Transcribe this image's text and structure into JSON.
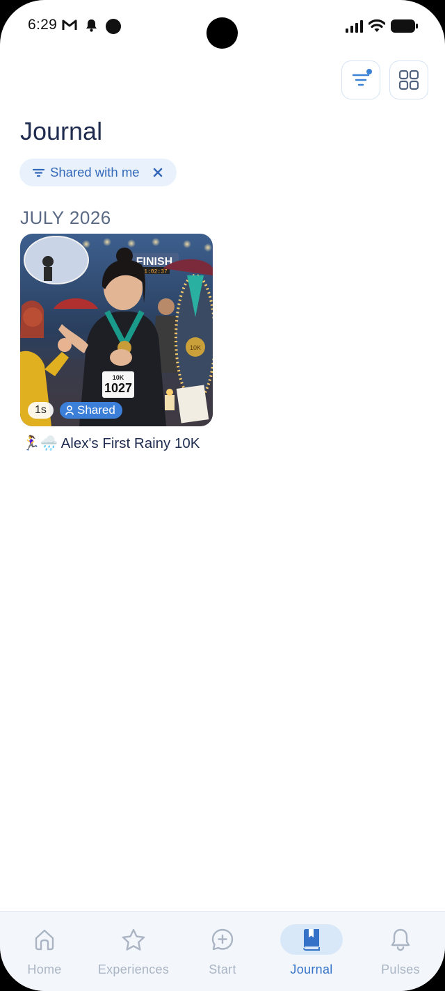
{
  "status_bar": {
    "time": "6:29",
    "left_icons": [
      "gmail-icon",
      "notification-bell-icon",
      "dot-icon"
    ],
    "right_icons": [
      "signal-icon",
      "wifi-icon",
      "battery-icon"
    ]
  },
  "toolbar": {
    "filter_icon": "filter-icon",
    "grid_icon": "grid-view-icon",
    "accent": "#3b82d6"
  },
  "header": {
    "title": "Journal"
  },
  "filter_chip": {
    "label": "Shared with me",
    "icon": "filter-icon",
    "close_icon": "close-icon"
  },
  "sections": [
    {
      "title": "JULY 2026",
      "entries": [
        {
          "duration": "1s",
          "shared_label": "Shared",
          "title": "🏃‍♀️🌧️ Alex's First Rainy 10K",
          "image_text": {
            "finish": "FINISH",
            "clock": "1:02:37",
            "bib_top": "10K",
            "bib_number": "1027",
            "medal": "10K"
          }
        }
      ]
    }
  ],
  "bottom_nav": {
    "items": [
      {
        "label": "Home",
        "icon": "home-icon"
      },
      {
        "label": "Experiences",
        "icon": "star-icon"
      },
      {
        "label": "Start",
        "icon": "chat-plus-icon"
      },
      {
        "label": "Journal",
        "icon": "journal-book-icon"
      },
      {
        "label": "Pulses",
        "icon": "bell-icon"
      }
    ],
    "active": "Journal",
    "active_color": "#3572c7",
    "inactive_color": "#aab4c2"
  }
}
